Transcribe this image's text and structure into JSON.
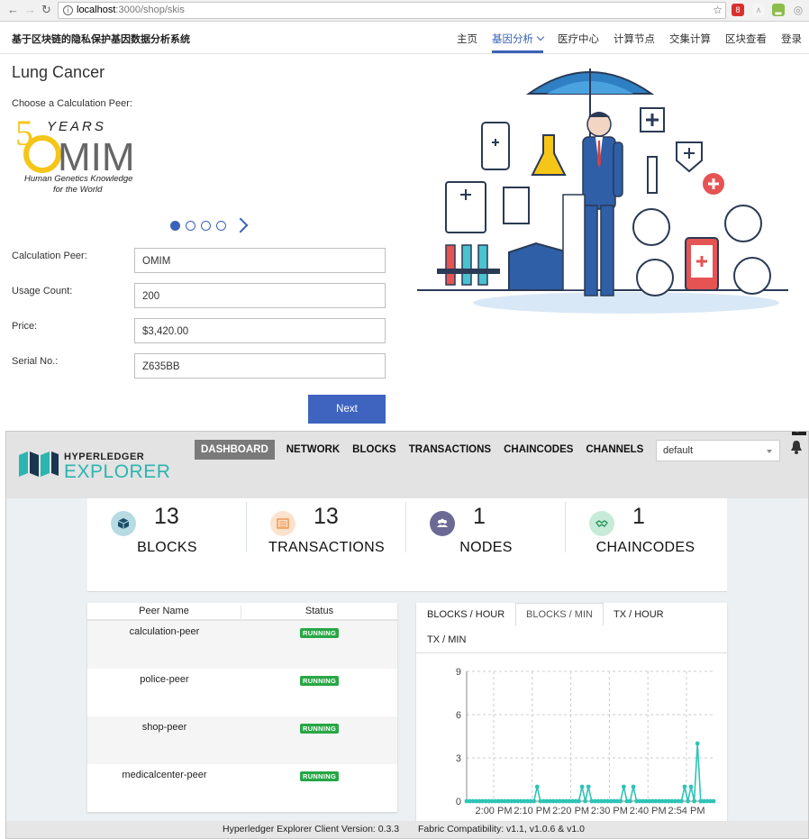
{
  "browser": {
    "url_host": "localhost",
    "url_path": ":3000/shop/skis"
  },
  "header": {
    "app_title": "基于区块链的隐私保护基因数据分析系统",
    "nav": [
      {
        "label": "主页"
      },
      {
        "label": "基因分析",
        "active": true
      },
      {
        "label": "医疗中心"
      },
      {
        "label": "计算节点"
      },
      {
        "label": "交集计算"
      },
      {
        "label": "区块查看"
      },
      {
        "label": "登录"
      }
    ]
  },
  "main": {
    "page_title": "Lung Cancer",
    "choose_label": "Choose a Calculation Peer:",
    "logo": {
      "years_number": "5",
      "years_text": "YEARS",
      "brand": "MIM",
      "tagline_1": "Human Genetics Knowledge",
      "tagline_2": "for the World"
    },
    "carousel": {
      "current": 1,
      "total": 4
    },
    "form": {
      "calc_peer_label": "Calculation Peer:",
      "calc_peer_value": "OMIM",
      "usage_label": "Usage Count:",
      "usage_value": "200",
      "price_label": "Price:",
      "price_value": "$3,420.00",
      "serial_label": "Serial No.:",
      "serial_value": "Z635BB"
    },
    "next_label": "Next"
  },
  "explorer": {
    "logo_top": "HYPERLEDGER",
    "logo_bottom": "EXPLORER",
    "menu": {
      "dashboard": "DASHBOARD",
      "network": "NETWORK",
      "blocks": "BLOCKS",
      "transactions": "TRANSACTIONS",
      "chaincodes": "CHAINCODES",
      "channels": "CHANNELS"
    },
    "channel_select": "default",
    "stats": [
      {
        "value": "13",
        "label": "BLOCKS",
        "color": "#b7dbe3",
        "icon": "cube-icon"
      },
      {
        "value": "13",
        "label": "TRANSACTIONS",
        "color": "#fde3cf",
        "icon": "list-icon"
      },
      {
        "value": "1",
        "label": "NODES",
        "color": "#6c6a95",
        "icon": "users-icon"
      },
      {
        "value": "1",
        "label": "CHAINCODES",
        "color": "#c7ebd8",
        "icon": "handshake-icon"
      }
    ],
    "peer_table": {
      "col_name": "Peer Name",
      "col_status": "Status",
      "rows": [
        {
          "name": "calculation-peer",
          "status": "RUNNING"
        },
        {
          "name": "police-peer",
          "status": "RUNNING"
        },
        {
          "name": "shop-peer",
          "status": "RUNNING"
        },
        {
          "name": "medicalcenter-peer",
          "status": "RUNNING"
        }
      ]
    },
    "chart_tabs": {
      "blocks_hour": "BLOCKS / HOUR",
      "blocks_min": "BLOCKS / MIN",
      "tx_hour": "TX / HOUR",
      "tx_min": "TX / MIN"
    },
    "footer": {
      "version": "Hyperledger Explorer Client Version: 0.3.3",
      "fabric": "Fabric Compatibility: v1.1, v1.0.6 & v1.0"
    }
  },
  "chart_data": {
    "type": "line",
    "title": "",
    "ylim": [
      0,
      9
    ],
    "yticks": [
      0,
      3,
      6,
      9
    ],
    "xticks": [
      "2:00 PM",
      "2:10 PM",
      "2:20 PM",
      "2:30 PM",
      "2:40 PM",
      "2:54 PM"
    ],
    "grid": true,
    "color": "#2ec4b6",
    "values": [
      0,
      0,
      0,
      0,
      0,
      0,
      0,
      0,
      0,
      0,
      0,
      0,
      0,
      0,
      0,
      0,
      0,
      0,
      0,
      0,
      0,
      0,
      1,
      0,
      0,
      0,
      0,
      0,
      0,
      0,
      0,
      0,
      0,
      0,
      0,
      0,
      1,
      0,
      1,
      0,
      0,
      0,
      0,
      0,
      0,
      0,
      0,
      0,
      0,
      1,
      0,
      0,
      1,
      0,
      0,
      0,
      0,
      0,
      0,
      0,
      0,
      0,
      0,
      0,
      0,
      0,
      0,
      0,
      1,
      0,
      1,
      0,
      4,
      0,
      0,
      0,
      0,
      0
    ]
  }
}
